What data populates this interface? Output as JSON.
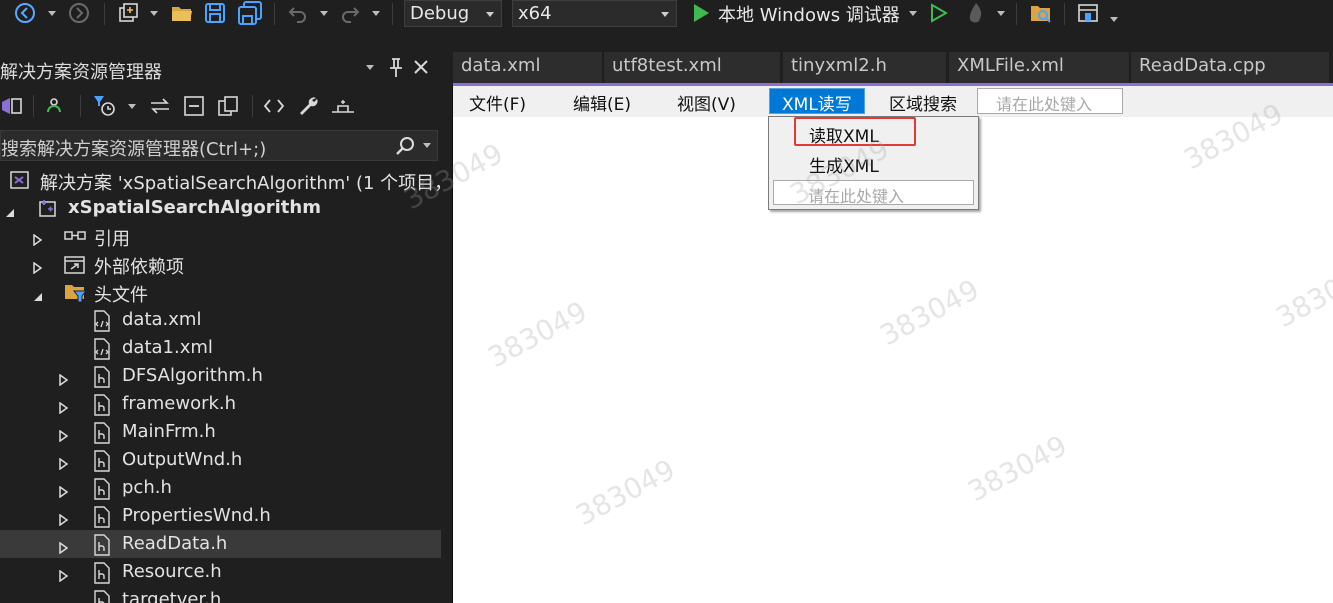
{
  "toolbar": {
    "configuration": "Debug",
    "platform": "x64",
    "run_target": "本地 Windows 调试器"
  },
  "solution_explorer": {
    "title": "解决方案资源管理器",
    "search_placeholder": "搜索解决方案资源管理器(Ctrl+;)",
    "tree": [
      {
        "label": "解决方案 'xSpatialSearchAlgorithm' (1 个项目，",
        "icon": "solution-icon"
      },
      {
        "label": "xSpatialSearchAlgorithm",
        "icon": "project-icon"
      },
      {
        "label": "引用",
        "icon": "references-icon"
      },
      {
        "label": "外部依赖项",
        "icon": "external-deps-icon"
      },
      {
        "label": "头文件",
        "icon": "filter-folder-icon"
      },
      {
        "label": "data.xml",
        "icon": "xml-file-icon"
      },
      {
        "label": "data1.xml",
        "icon": "xml-file-icon"
      },
      {
        "label": "DFSAlgorithm.h",
        "icon": "header-file-icon"
      },
      {
        "label": "framework.h",
        "icon": "header-file-icon"
      },
      {
        "label": "MainFrm.h",
        "icon": "header-file-icon"
      },
      {
        "label": "OutputWnd.h",
        "icon": "header-file-icon"
      },
      {
        "label": "pch.h",
        "icon": "header-file-icon"
      },
      {
        "label": "PropertiesWnd.h",
        "icon": "header-file-icon"
      },
      {
        "label": "ReadData.h",
        "icon": "header-file-icon"
      },
      {
        "label": "Resource.h",
        "icon": "header-file-icon"
      },
      {
        "label": "targetver.h",
        "icon": "header-file-icon"
      }
    ]
  },
  "doc_tabs": [
    "data.xml",
    "utf8test.xml",
    "tinyxml2.h",
    "XMLFile.xml",
    "ReadData.cpp"
  ],
  "designer": {
    "menu": [
      "文件(F)",
      "编辑(E)",
      "视图(V)",
      "XML读写",
      "区域搜索"
    ],
    "menu_type_here": "请在此处键入",
    "dropdown": [
      "读取XML",
      "生成XML"
    ],
    "dropdown_type_here": "请在此处键入"
  },
  "watermark": "383049",
  "colors": {
    "accent": "#8b6fd8",
    "menu_active": "#0078d7",
    "highlight_box": "#e53935",
    "run_green": "#3fb950"
  }
}
